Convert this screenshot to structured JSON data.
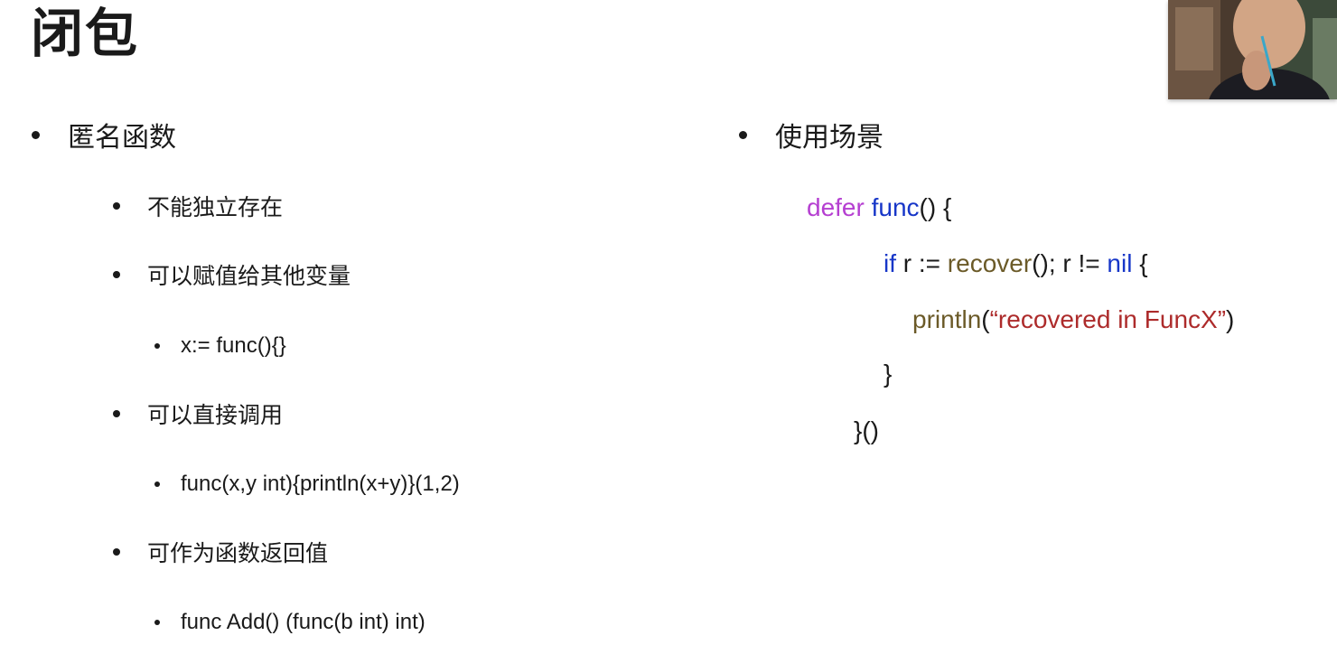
{
  "slide": {
    "title": "闭包",
    "left_column": {
      "heading": "匿名函数",
      "items": [
        {
          "text": "不能独立存在"
        },
        {
          "text": "可以赋值给其他变量",
          "sub": "x:= func(){}"
        },
        {
          "text": "可以直接调用",
          "sub": "func(x,y int){println(x+y)}(1,2)"
        },
        {
          "text": "可作为函数返回值",
          "sub": "func Add() (func(b int) int)"
        }
      ]
    },
    "right_column": {
      "heading": "使用场景",
      "code": {
        "line1": {
          "kw": "defer",
          "fn": "func",
          "rest": "() {"
        },
        "line2": {
          "kw": "if",
          "a": " r := ",
          "call": "recover",
          "b": "(); r != ",
          "nil": "nil",
          "c": " {"
        },
        "line3": {
          "call": "println",
          "open": "(",
          "str": "“recovered in FuncX”",
          "close": ")"
        },
        "line4": {
          "text": "}"
        },
        "line5": {
          "text": "}()"
        }
      }
    }
  },
  "colors": {
    "keyword": "#b53fd1",
    "function": "#1736c8",
    "call": "#6b5a28",
    "string": "#ad2b2b"
  },
  "webcam": {
    "subject": "presenter-video"
  }
}
